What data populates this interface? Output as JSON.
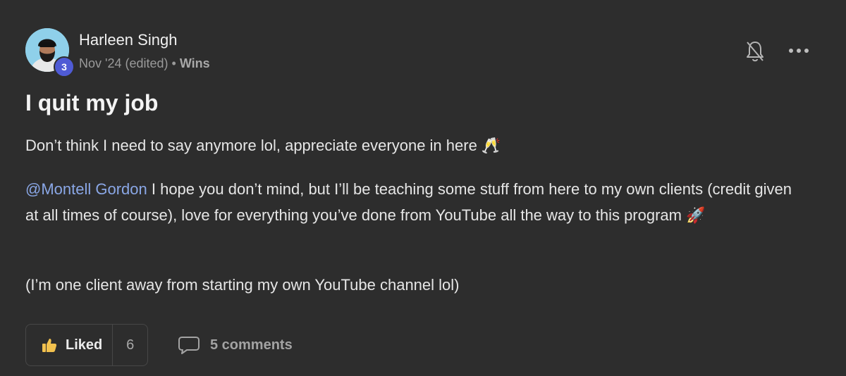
{
  "post": {
    "author": {
      "name": "Harleen Singh",
      "level": "3",
      "avatar_icon": "profile-photo"
    },
    "meta": {
      "date": "Nov '24 (edited)",
      "separator": "•",
      "category": "Wins"
    },
    "title": "I quit my job",
    "paragraphs": {
      "p1": "Don’t think I need to say anymore lol, appreciate everyone in here 🥂",
      "p2_mention": "@Montell Gordon",
      "p2_rest": " I hope you don’t mind, but I’ll be teaching some stuff from here to my own clients (credit given at all times of course), love for everything you’ve done from YouTube all the way to this program 🚀",
      "p3": "(I’m one client away from starting my own YouTube channel lol)"
    },
    "actions": {
      "like_label": "Liked",
      "like_count": "6",
      "comments_label": "5 comments"
    },
    "icons": {
      "bell": "bell-off-icon",
      "more": "more-horizontal-icon",
      "like": "thumbs-up-icon",
      "comment": "comment-bubble-icon"
    },
    "colors": {
      "background": "#2d2d2d",
      "mention": "#8aa7e6",
      "badge": "#4f5bd5"
    }
  }
}
